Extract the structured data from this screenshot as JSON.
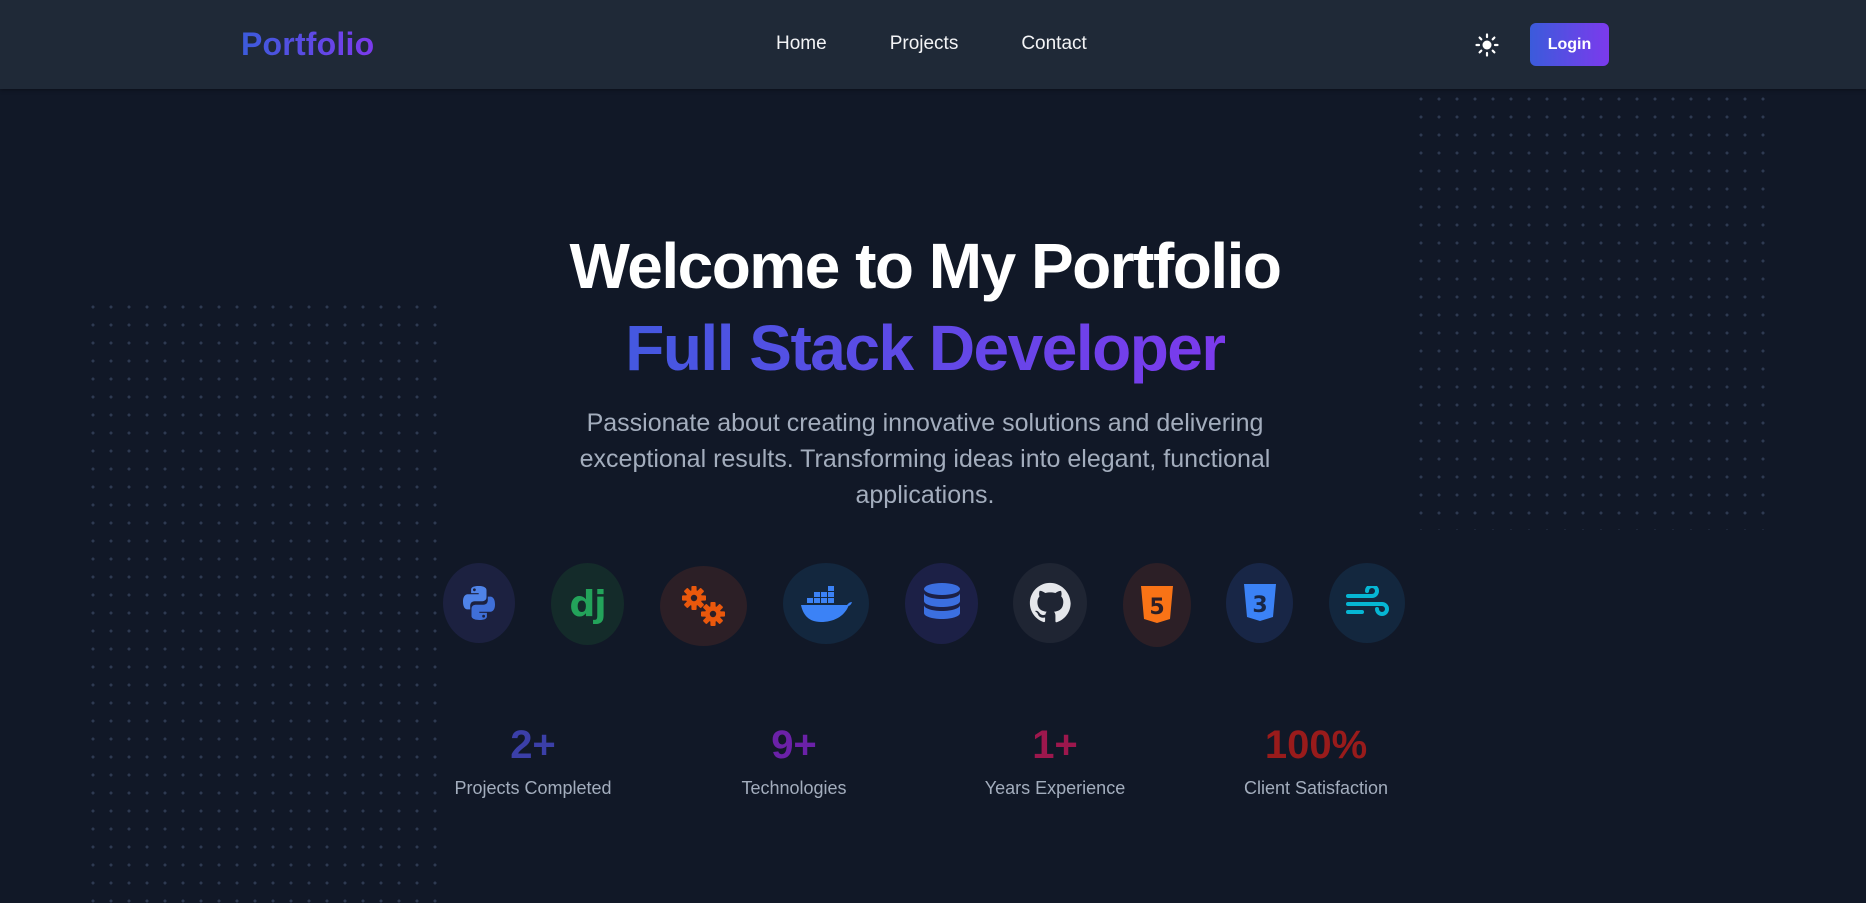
{
  "navbar": {
    "brand": "Portfolio",
    "links": [
      {
        "label": "Home"
      },
      {
        "label": "Projects"
      },
      {
        "label": "Contact"
      }
    ],
    "theme_toggle_icon": "sun-icon",
    "login_label": "Login"
  },
  "hero": {
    "title": "Welcome to My Portfolio",
    "subtitle": "Full Stack Developer",
    "description": "Passionate about creating innovative solutions and delivering exceptional results. Transforming ideas into elegant, functional applications."
  },
  "tech_icons": [
    {
      "name": "python-icon",
      "color": "#4f83e8"
    },
    {
      "name": "django-icon",
      "text": "dj",
      "color": "#23a35a"
    },
    {
      "name": "gears-icon",
      "color": "#ea580c"
    },
    {
      "name": "docker-icon",
      "color": "#3b82f6"
    },
    {
      "name": "database-icon",
      "color": "#3b6fe0"
    },
    {
      "name": "github-icon",
      "color": "#e5e7eb"
    },
    {
      "name": "html5-icon",
      "text": "5",
      "color": "#f97316"
    },
    {
      "name": "css3-icon",
      "text": "3",
      "color": "#3b82f6"
    },
    {
      "name": "tailwind-icon",
      "color": "#06b6d4"
    }
  ],
  "stats": [
    {
      "value": "2+",
      "label": "Projects Completed",
      "color": "#3b3fa8"
    },
    {
      "value": "9+",
      "label": "Technologies",
      "color": "#6b21a8"
    },
    {
      "value": "1+",
      "label": "Years Experience",
      "color": "#9d174d"
    },
    {
      "value": "100%",
      "label": "Client Satisfaction",
      "color": "#991b1b"
    }
  ]
}
